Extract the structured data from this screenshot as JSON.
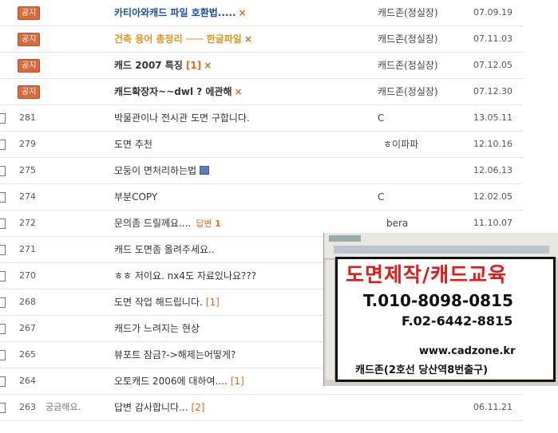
{
  "notices": [
    {
      "badge": "공지",
      "title": "카티아와캐드 파일 호환법.....",
      "style": "notice-blue",
      "count": "",
      "author": "캐드존(정실장)",
      "date": "07.09.19"
    },
    {
      "badge": "공지",
      "title": "건축 용어 총정리 ─── 한글파일",
      "style": "notice-orange",
      "count": "",
      "author": "캐드존(정실장)",
      "date": "07.11.03"
    },
    {
      "badge": "공지",
      "title": "캐드 2007 특징",
      "style": "notice-dark",
      "count": "[1]",
      "author": "캐드존(정실장)",
      "date": "07.12.05"
    },
    {
      "badge": "공지",
      "title": "캐드확장자~~dwl ? 에관해",
      "style": "notice-dark",
      "count": "",
      "author": "캐드존(정실장)",
      "date": "07.12.30"
    }
  ],
  "posts": [
    {
      "num": "281",
      "cat": "",
      "title": "박물관이나 전시관 도면 구합니다.",
      "count": "",
      "author": "C",
      "date": "13.05.11"
    },
    {
      "num": "279",
      "cat": "",
      "title": "도면 추천",
      "count": "",
      "author": "ㅎ이파파",
      "date": "12.10.16"
    },
    {
      "num": "275",
      "cat": "",
      "title": "모둥이 면처리하는법",
      "count": "",
      "author": "",
      "date": "12.06.13"
    },
    {
      "num": "274",
      "cat": "",
      "title": "부분COPY",
      "count": "",
      "author": "C",
      "date": "12.02.05"
    },
    {
      "num": "272",
      "cat": "",
      "title": "문의좀 드릴께요....",
      "count": "",
      "author": "bera",
      "date": "11.10.07"
    },
    {
      "num": "271",
      "cat": "",
      "title": "캐드 도면좀 올려주세요..",
      "count": "",
      "author": "",
      "date": ""
    },
    {
      "num": "270",
      "cat": "",
      "title": "ㅎㅎ 저이요. nx4도 자료있나요???",
      "count": "",
      "author": "",
      "date": ""
    },
    {
      "num": "268",
      "cat": "",
      "title": "도면 작업 해드립니다.",
      "count": "[1]",
      "author": "",
      "date": ""
    },
    {
      "num": "267",
      "cat": "",
      "title": "캐드가 느려지는 현상",
      "count": "",
      "author": "",
      "date": ""
    },
    {
      "num": "265",
      "cat": "",
      "title": "뷰포트 잠금?->해제는어떻게?",
      "count": "",
      "author": "",
      "date": ""
    },
    {
      "num": "264",
      "cat": "",
      "title": "오토캐드 2006에 대하여....",
      "count": "[1]",
      "author": "",
      "date": ""
    },
    {
      "num": "263",
      "cat": "궁금해요.",
      "title": "답변 감사합니다...",
      "count": "[2]",
      "author": "",
      "date": "06.11.21"
    }
  ],
  "reply_tag": {
    "label": "답변",
    "count": "1"
  },
  "close_mark": "×",
  "ad": {
    "headline": "도면제작/캐드교육",
    "phone": "T.010-8098-0815",
    "fax": "F.02-6442-8815",
    "website": "www.cadzone.kr",
    "address": "캐드존(2호선 당산역8번출구)"
  },
  "colors": {
    "accent": "#e06a1a",
    "notice_blue": "#1a4fa3",
    "notice_orange": "#e3941b",
    "ad_red": "#e11a1a"
  }
}
